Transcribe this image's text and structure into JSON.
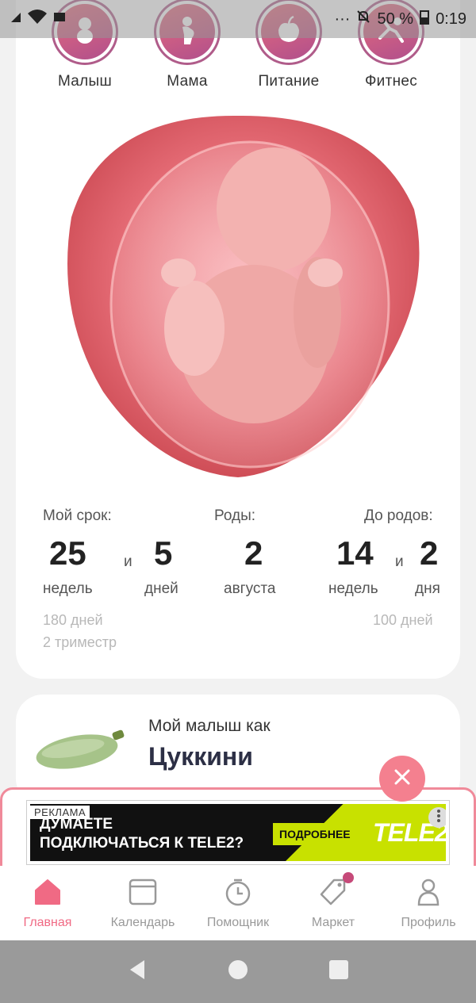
{
  "status_bar": {
    "battery": "50 %",
    "time": "0:19"
  },
  "categories": [
    {
      "label": "Малыш",
      "icon": "baby-icon"
    },
    {
      "label": "Мама",
      "icon": "pregnant-woman-icon"
    },
    {
      "label": "Питание",
      "icon": "apple-icon"
    },
    {
      "label": "Фитнес",
      "icon": "fitness-icon"
    }
  ],
  "pregnancy": {
    "term_label": "Мой срок:",
    "weeks": "25",
    "and1": "и",
    "days": "5",
    "weeks_unit": "недель",
    "days_unit": "дней",
    "birth_label": "Роды:",
    "birth_day": "2",
    "birth_month": "августа",
    "until_label": "До родов:",
    "until_weeks": "14",
    "and2": "и",
    "until_days": "2",
    "until_weeks_unit": "недель",
    "until_days_unit": "дня",
    "days_total": "180 дней",
    "trimester": "2 триместр",
    "days_left": "100 дней"
  },
  "baby_size": {
    "label": "Мой малыш как",
    "name": "Цуккини"
  },
  "ad": {
    "tag": "РЕКЛАМА",
    "line1": "ДУМАЕТЕ",
    "line2": "ПОДКЛЮЧАТЬСЯ К TELE2?",
    "button": "ПОДРОБНЕЕ",
    "brand": "TELE2"
  },
  "nav": [
    {
      "label": "Главная",
      "icon": "home-icon",
      "active": true
    },
    {
      "label": "Календарь",
      "icon": "calendar-icon"
    },
    {
      "label": "Помощник",
      "icon": "stopwatch-icon"
    },
    {
      "label": "Маркет",
      "icon": "tag-icon"
    },
    {
      "label": "Профиль",
      "icon": "profile-icon"
    }
  ],
  "colors": {
    "accent": "#f06a84",
    "ring": "#b05c8a",
    "lime": "#c8e100"
  }
}
